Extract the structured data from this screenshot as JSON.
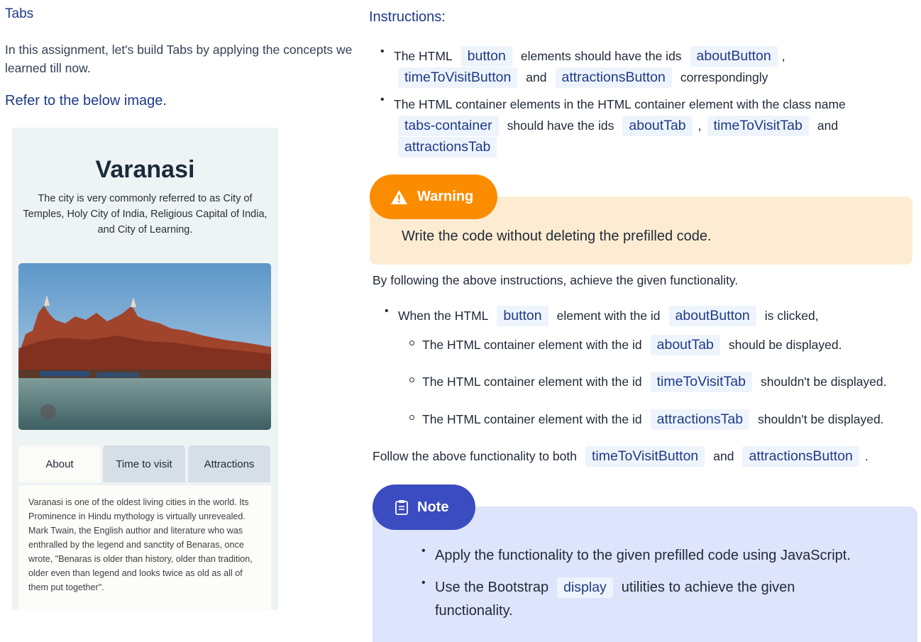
{
  "left": {
    "title": "Tabs",
    "intro": "In this assignment, let's build Tabs by applying the concepts we learned till now.",
    "refer": "Refer to the below image.",
    "preview": {
      "heading": "Varanasi",
      "description": "The city is very commonly referred to as City of Temples, Holy City of India, Religious Capital of India, and City of Learning.",
      "tabs": [
        "About",
        "Time to visit",
        "Attractions"
      ],
      "active_tab": "About",
      "tab_text": "Varanasi is one of the oldest living cities in the world. Its Prominence in Hindu mythology is virtually unrevealed. Mark Twain, the English author and literature who was enthralled by the legend and sanctity of Benaras, once wrote, \"Benaras is older than history, older than tradition, older even than legend and looks twice as old as all of them put together\"."
    }
  },
  "right": {
    "heading": "Instructions:",
    "b1": {
      "t1": "The HTML",
      "c1": "button",
      "t2": "elements should have the ids",
      "c2": "aboutButton",
      "t3": ",",
      "c3": "timeToVisitButton",
      "t4": "and",
      "c4": "attractionsButton",
      "t5": "correspondingly"
    },
    "b2": {
      "t1": "The HTML container elements in the HTML container element with the class name",
      "c1": "tabs-container",
      "t2": "should have the ids",
      "c2": "aboutTab",
      "t3": ",",
      "c3": "timeToVisitTab",
      "t4": "and",
      "c4": "attractionsTab"
    },
    "warning": {
      "label": "Warning",
      "text": "Write the code without deleting the prefilled code."
    },
    "following": "By following the above instructions, achieve the given functionality.",
    "b3": {
      "t1": "When the HTML",
      "c1": "button",
      "t2": "element with the id",
      "c2": "aboutButton",
      "t3": "is clicked,"
    },
    "subs": [
      {
        "t1": "The HTML container element with the id",
        "code": "aboutTab",
        "t2": "should be displayed."
      },
      {
        "t1": "The HTML container element with the id",
        "code": "timeToVisitTab",
        "t2": "shouldn't be displayed."
      },
      {
        "t1": "The HTML container element with the id",
        "code": "attractionsTab",
        "t2": "shouldn't be displayed."
      }
    ],
    "follow": {
      "t1": "Follow the above functionality to both",
      "c1": "timeToVisitButton",
      "t2": "and",
      "c2": "attractionsButton",
      "t3": "."
    },
    "note": {
      "label": "Note",
      "i1": "Apply the functionality to the given prefilled code using JavaScript.",
      "i2_t1": "Use the Bootstrap",
      "i2_code": "display",
      "i2_t2": "utilities to achieve the given",
      "i2_t3": "functionality."
    }
  },
  "colors": {
    "warning": "#fb8c00",
    "warning_bg": "#feecd2",
    "note": "#3b4cc0",
    "note_bg": "#dde4fb",
    "heading": "#1e3a8a"
  }
}
